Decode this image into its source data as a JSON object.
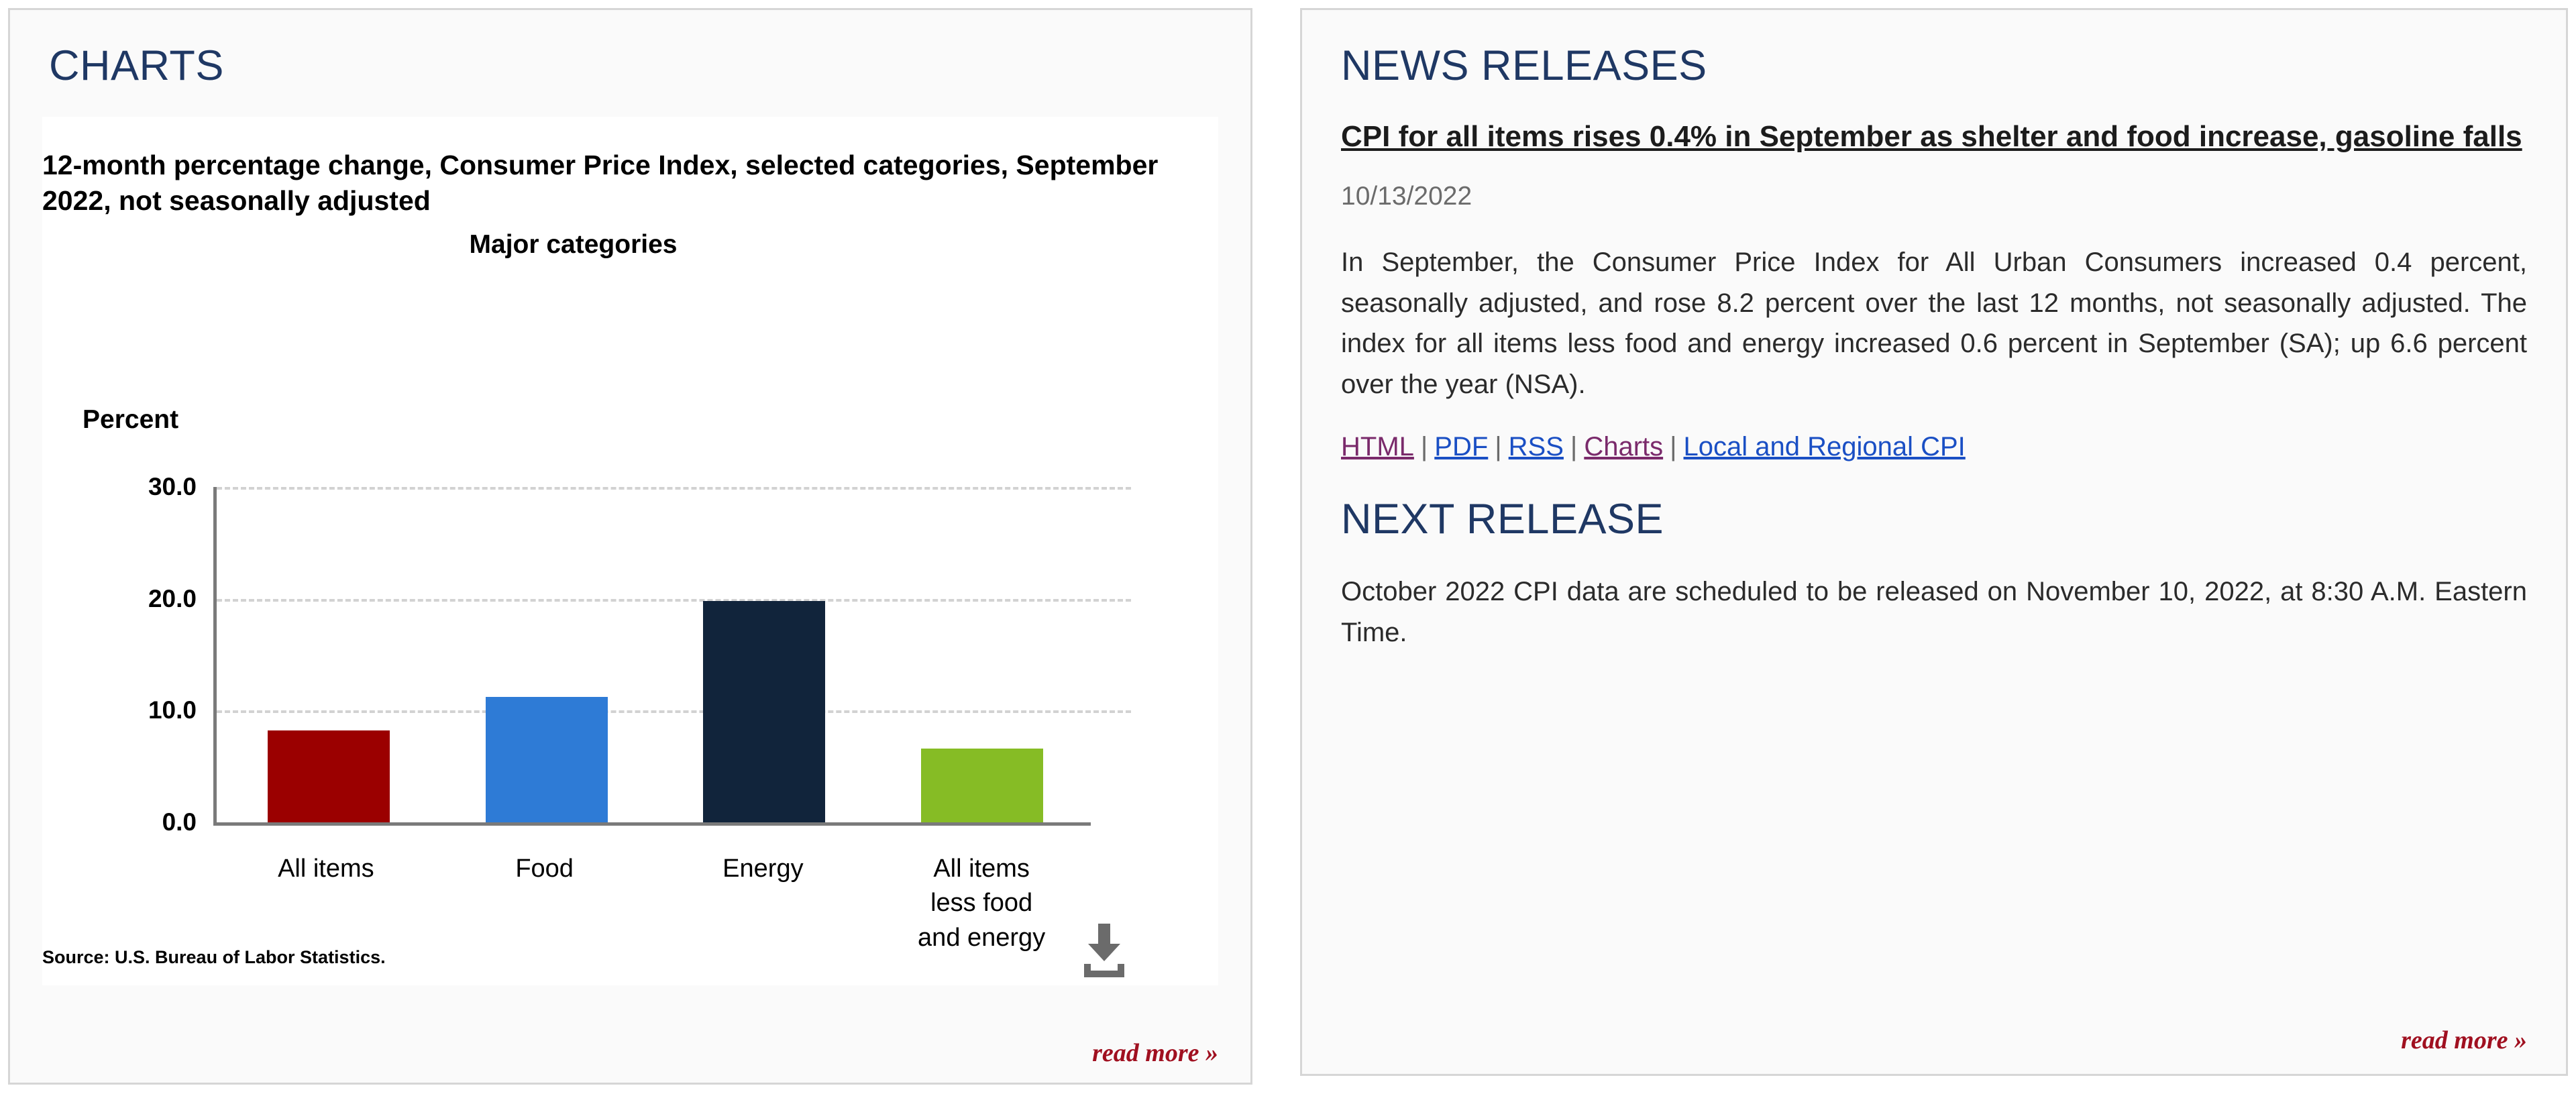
{
  "charts_panel": {
    "header": "CHARTS",
    "read_more": "read more »",
    "source_note": "Source: U.S. Bureau of Labor Statistics.",
    "download_icon_name": "download-icon"
  },
  "news_panel": {
    "header": "NEWS RELEASES",
    "headline": "CPI for all items rises 0.4% in September as shelter and food increase, gasoline falls",
    "date": "10/13/2022",
    "paragraph": "In September, the Consumer Price Index for All Urban Consumers increased 0.4 percent, seasonally adjusted, and rose 8.2 percent over the last 12 months, not seasonally adjusted. The index for all items less food and energy increased 0.6 percent in September (SA); up 6.6 percent over the year (NSA).",
    "links": [
      {
        "label": "HTML",
        "style": "visited"
      },
      {
        "label": "PDF",
        "style": "blue"
      },
      {
        "label": "RSS",
        "style": "blue"
      },
      {
        "label": "Charts",
        "style": "visited"
      },
      {
        "label": "Local and Regional CPI",
        "style": "blue"
      }
    ],
    "link_separator": "|",
    "next_release_header": "NEXT RELEASE",
    "next_release_text": "October 2022 CPI data are scheduled to be released on November 10, 2022, at 8:30 A.M. Eastern Time.",
    "read_more": "read more »"
  },
  "chart_data": {
    "type": "bar",
    "title": "12-month percentage change, Consumer Price Index, selected categories, September 2022, not seasonally adjusted",
    "subtitle": "Major categories",
    "ylabel": "Percent",
    "xlabel": "",
    "categories": [
      "All items",
      "Food",
      "Energy",
      "All items\nless food\nand energy"
    ],
    "values": [
      8.2,
      11.2,
      19.8,
      6.6
    ],
    "colors": [
      "#9b0000",
      "#2e7bd6",
      "#11243b",
      "#86bc25"
    ],
    "ylim": [
      0,
      30
    ],
    "yticks": [
      "0.0",
      "10.0",
      "20.0",
      "30.0"
    ],
    "ytick_values": [
      0,
      10,
      20,
      30
    ],
    "grid": true,
    "legend": "none"
  }
}
